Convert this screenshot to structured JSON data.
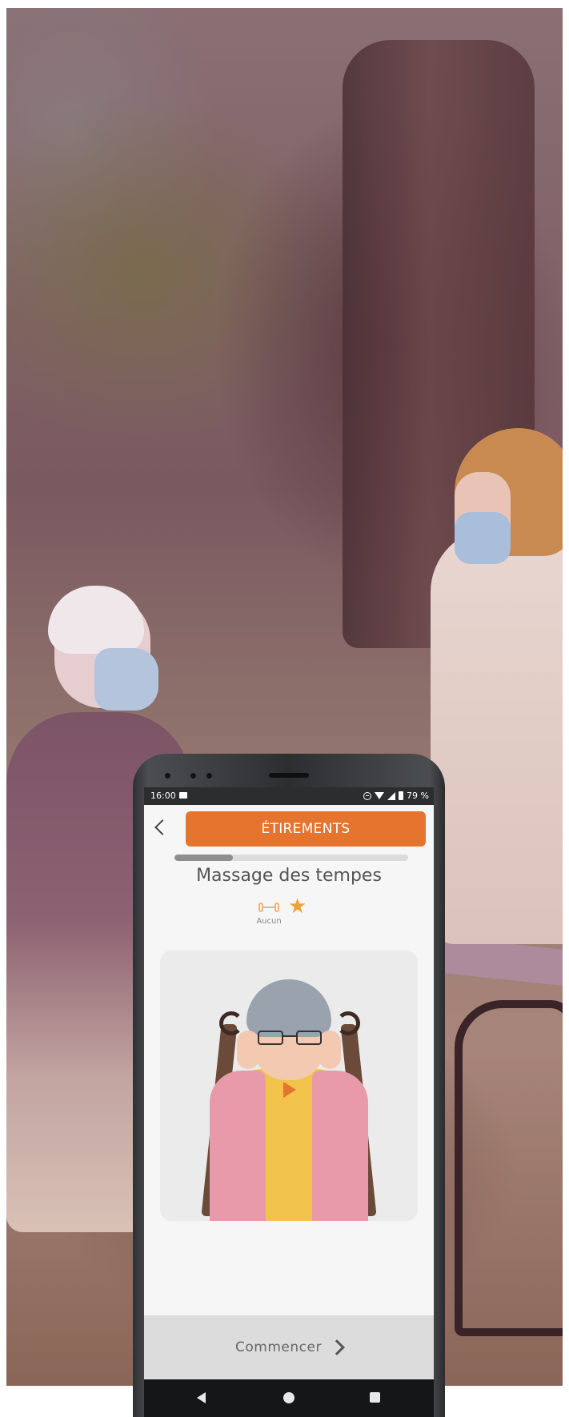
{
  "status_bar": {
    "time": "16:00",
    "battery": "79 %"
  },
  "header": {
    "title": "ÉTIREMENTS"
  },
  "progress": {
    "fraction": 0.25
  },
  "exercise": {
    "title": "Massage des tempes",
    "equipment_label": "Aucun",
    "difficulty_stars": 1
  },
  "footer": {
    "start_label": "Commencer"
  },
  "colors": {
    "accent": "#e4742e",
    "star": "#f0a23a"
  },
  "icons": {
    "back": "chevron-left-icon",
    "equipment": "dumbbell-icon",
    "difficulty": "star-icon",
    "play": "play-icon",
    "start": "chevron-right-icon",
    "nav": [
      "nav-back-icon",
      "nav-home-icon",
      "nav-recents-icon"
    ]
  }
}
